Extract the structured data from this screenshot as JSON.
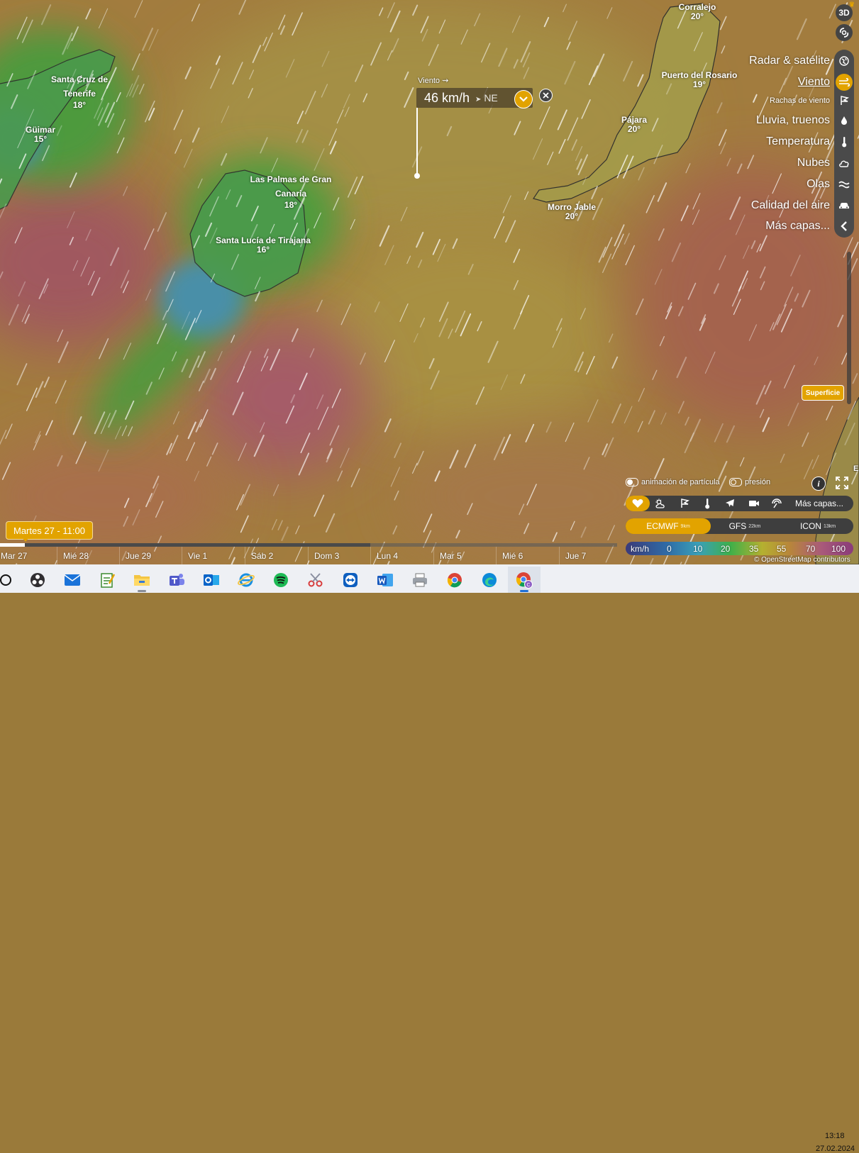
{
  "map": {
    "places": [
      {
        "id": "corralejo",
        "name": [
          "Corralejo"
        ],
        "temp": "20°"
      },
      {
        "id": "puerto-del-rosario",
        "name": [
          "Puerto del Rosario"
        ],
        "temp": "19°"
      },
      {
        "id": "pajara",
        "name": [
          "Pájara"
        ],
        "temp": "20°"
      },
      {
        "id": "morro-jable",
        "name": [
          "Morro Jable"
        ],
        "temp": "20°"
      },
      {
        "id": "santa-cruz",
        "name": [
          "Santa Cruz de",
          "Tenerife"
        ],
        "temp": "18°"
      },
      {
        "id": "guimar",
        "name": [
          "Güimar"
        ],
        "temp": "15°"
      },
      {
        "id": "las-palmas",
        "name": [
          "Las Palmas de Gran",
          "Canaria"
        ],
        "temp": "18°"
      },
      {
        "id": "santa-lucia",
        "name": [
          "Santa Lucía de Tirajana"
        ],
        "temp": "16°"
      }
    ],
    "edge_letter": "E",
    "attribution": "© OpenStreetMap contributors"
  },
  "popup": {
    "layer_label": "Viento",
    "speed": "46 km/h",
    "direction": "NE"
  },
  "top_buttons": {
    "three_d": "3D"
  },
  "menu": {
    "items": [
      {
        "label": "Radar & satélite",
        "icon": "globe-icon"
      },
      {
        "label": "Viento",
        "icon": "wind-icon",
        "active": true
      },
      {
        "label": "Rachas de viento",
        "icon": "flag-icon"
      },
      {
        "label": "Lluvia, truenos",
        "icon": "raindrop-icon"
      },
      {
        "label": "Temperatura",
        "icon": "thermometer-icon"
      },
      {
        "label": "Nubes",
        "icon": "cloud-icon"
      },
      {
        "label": "Olas",
        "icon": "waves-icon"
      },
      {
        "label": "Calidad del aire",
        "icon": "car-icon"
      },
      {
        "label": "Más capas...",
        "icon": "chevron-left-icon"
      }
    ]
  },
  "altitude": {
    "label": "Superficie"
  },
  "overlay_toggles": {
    "particles": "animación de partícula",
    "pressure": "presión"
  },
  "layer_bar": {
    "more_label": "Más capas..."
  },
  "models": [
    {
      "name": "ECMWF",
      "res": "9km",
      "active": true
    },
    {
      "name": "GFS",
      "res": "22km"
    },
    {
      "name": "ICON",
      "res": "13km"
    }
  ],
  "legend": {
    "unit": "km/h",
    "values": [
      "0",
      "10",
      "20",
      "35",
      "55",
      "70",
      "100"
    ]
  },
  "timeline": {
    "current": "Martes 27 - 11:00",
    "days": [
      "Mar 27",
      "Mié 28",
      "Jue 29",
      "Vie 1",
      "Sáb 2",
      "Dom 3",
      "Lun 4",
      "Mar 5",
      "Mié 6",
      "Jue 7"
    ],
    "loaded_fraction": 0.6,
    "progress_fraction": 0.04
  },
  "taskbar": {
    "apps": [
      "search",
      "obs-studio",
      "mail",
      "notepad-plus",
      "file-explorer",
      "teams",
      "outlook",
      "internet-explorer",
      "spotify",
      "snipping-tool",
      "teamviewer",
      "word",
      "printer",
      "chrome",
      "edge",
      "chrome-profile"
    ],
    "time": "13:18",
    "date": "27.02.2024"
  },
  "colors": {
    "accent": "#e2a300",
    "panel": "#3e3e3e"
  }
}
